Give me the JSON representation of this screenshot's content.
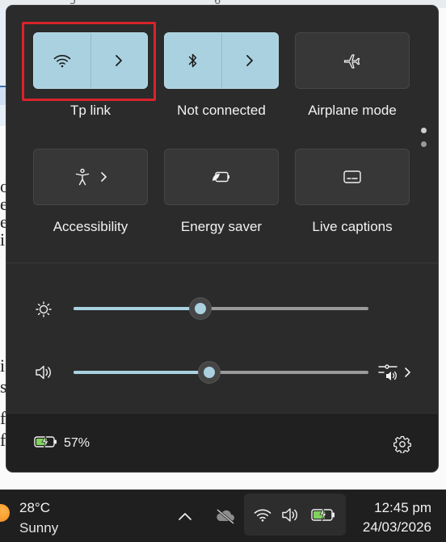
{
  "colors": {
    "panel_bg": "#2c2c2c",
    "tile_on": "#a9d1e0",
    "tile_off": "#373737",
    "focus_ring": "#d8232a",
    "taskbar_bg": "#1f1f1f",
    "battery_charge": "#7fd35a"
  },
  "background": {
    "ruler_marks": [
      "5",
      "6"
    ],
    "text_fragments": [
      "o",
      "e",
      "e",
      "i",
      "i",
      "s",
      "f",
      "f"
    ]
  },
  "quick_settings": {
    "tiles": [
      {
        "label": "Tp link",
        "icon": "wifi-icon",
        "state": "on",
        "has_chevron": true
      },
      {
        "label": "Not connected",
        "icon": "bluetooth-icon",
        "state": "on",
        "has_chevron": true
      },
      {
        "label": "Airplane mode",
        "icon": "airplane-icon",
        "state": "off",
        "has_chevron": false
      },
      {
        "label": "Accessibility",
        "icon": "accessibility-icon",
        "state": "off",
        "has_chevron": true
      },
      {
        "label": "Energy saver",
        "icon": "energy-saver-icon",
        "state": "off",
        "has_chevron": false
      },
      {
        "label": "Live captions",
        "icon": "live-captions-icon",
        "state": "off",
        "has_chevron": false
      }
    ],
    "brightness": {
      "icon": "brightness-icon",
      "level_percent": 43
    },
    "volume": {
      "icon": "speaker-icon",
      "level_percent": 46,
      "mixer_icon": "sound-mixer-icon"
    },
    "battery": {
      "icon": "battery-charging-icon",
      "percent_text": "57%"
    },
    "settings_icon": "gear-icon"
  },
  "taskbar": {
    "weather": {
      "temp": "28°C",
      "condition": "Sunny"
    },
    "tray_icons": [
      "chevron-up-icon",
      "onedrive-offline-icon",
      "wifi-icon",
      "speaker-icon",
      "battery-charging-icon"
    ],
    "clock": {
      "time": "12:45 pm",
      "date": "24/03/2026"
    }
  }
}
